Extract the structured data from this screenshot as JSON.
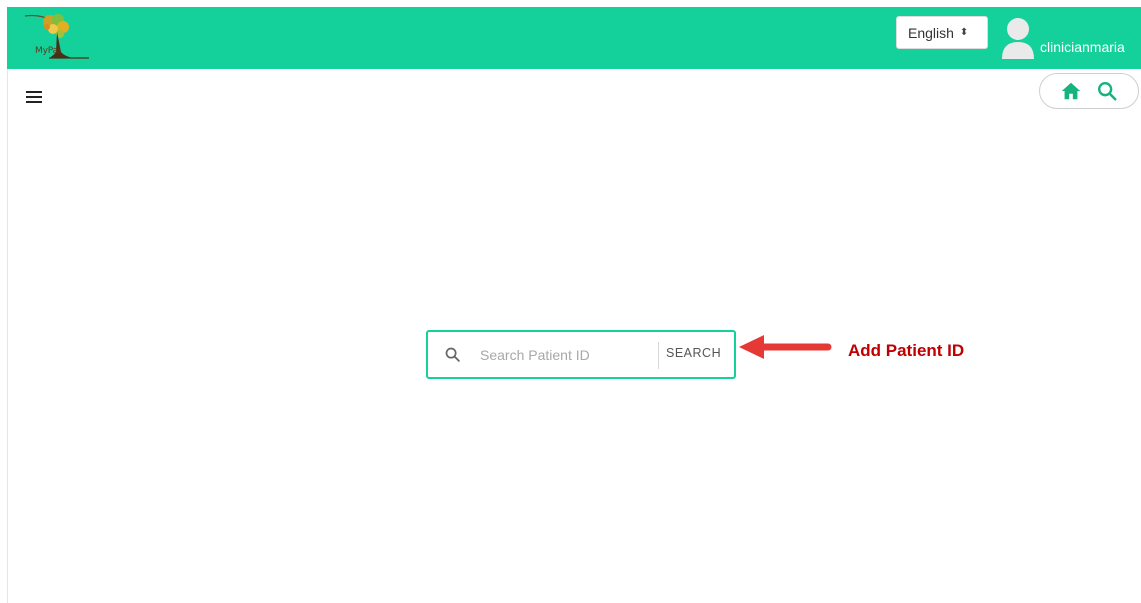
{
  "header": {
    "logo_text": "MyPal",
    "language": {
      "selected": "English"
    },
    "user": {
      "name": "clinicianmaria"
    }
  },
  "toolbar": {
    "home_icon": "home-icon",
    "search_icon": "search-icon"
  },
  "search": {
    "placeholder": "Search Patient ID",
    "value": "",
    "button_label": "SEARCH"
  },
  "annotation": {
    "label": "Add Patient ID",
    "color": "#c00000"
  },
  "colors": {
    "brand": "#14d19b",
    "arrow": "#e53935"
  }
}
